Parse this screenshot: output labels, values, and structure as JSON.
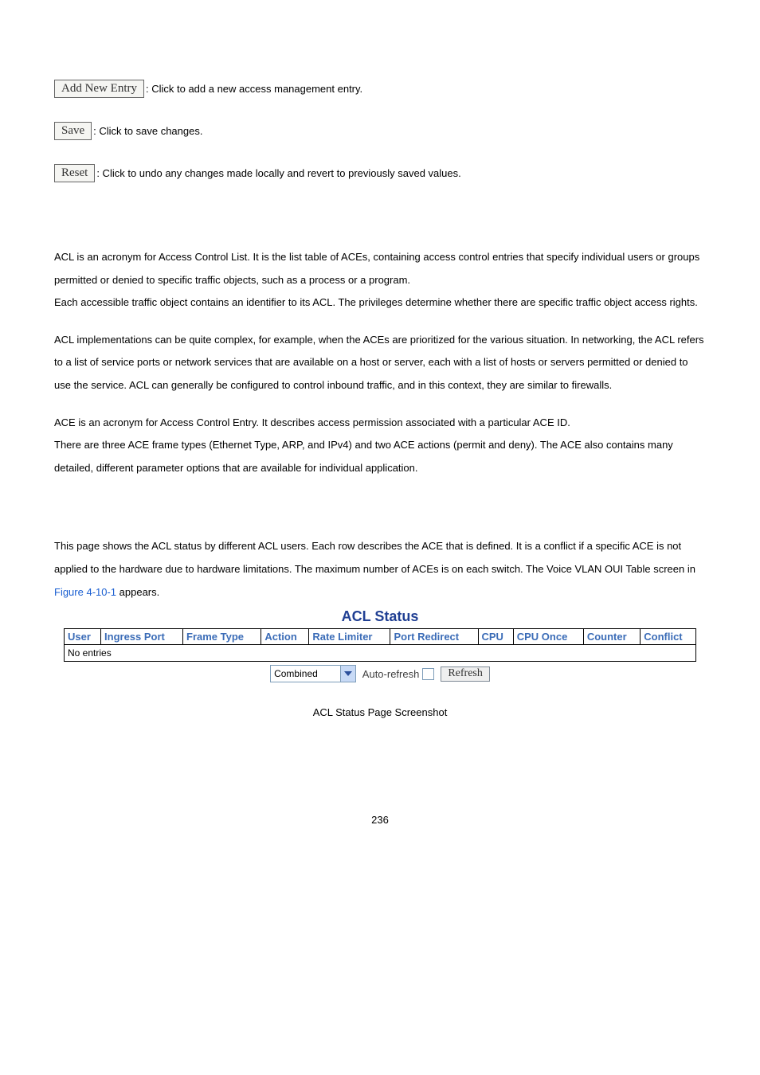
{
  "buttons": {
    "add_new_entry": {
      "label": "Add New Entry",
      "desc": ": Click to add a new access management entry."
    },
    "save": {
      "label": "Save",
      "desc": ": Click to save changes."
    },
    "reset": {
      "label": "Reset",
      "desc": ": Click to undo any changes made locally and revert to previously saved values."
    }
  },
  "para1": "ACL is an acronym for Access Control List. It is the list table of ACEs, containing access control entries that specify individual users or groups permitted or denied to specific traffic objects, such as a process or a program.",
  "para1b": "Each accessible traffic object contains an identifier to its ACL. The privileges determine whether there are specific traffic object access rights.",
  "para2": "ACL implementations can be quite complex, for example, when the ACEs are prioritized for the various situation. In networking, the ACL refers to a list of service ports or network services that are available on a host or server, each with a list of hosts or servers permitted or denied to use the service. ACL can generally be configured to control inbound traffic, and in this context, they are similar to firewalls.",
  "para3": "ACE is an acronym for Access Control Entry. It describes access permission associated with a particular ACE ID.",
  "para3b": "There are three ACE frame types (Ethernet Type, ARP, and IPv4) and two ACE actions (permit and deny). The ACE also contains many detailed, different parameter options that are available for individual application.",
  "para4_pre": "This page shows the ACL status by different ACL users. Each row describes the ACE that is defined. It is a conflict if a specific ACE is not applied to the hardware due to hardware limitations. The maximum number of ACEs is      on each switch. The Voice VLAN OUI Table screen in ",
  "para4_link": "Figure 4-10-1",
  "para4_post": " appears.",
  "panel": {
    "title": "ACL Status",
    "headers": [
      "User",
      "Ingress Port",
      "Frame Type",
      "Action",
      "Rate Limiter",
      "Port Redirect",
      "CPU",
      "CPU Once",
      "Counter",
      "Conflict"
    ],
    "no_entries": "No entries",
    "select_value": "Combined",
    "auto_refresh_label": "Auto-refresh",
    "refresh_label": "Refresh"
  },
  "caption": "ACL Status Page Screenshot",
  "page_number": "236"
}
